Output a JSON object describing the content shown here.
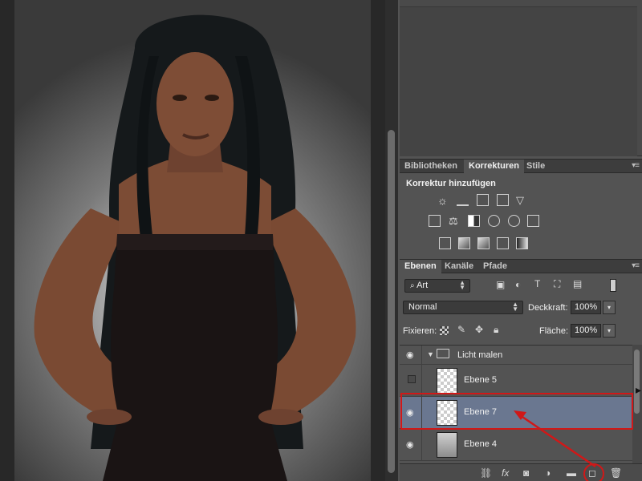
{
  "canvas": {
    "description_icon": "portrait-photo"
  },
  "adjustments_panel": {
    "tabs": [
      "Bibliotheken",
      "Korrekturen",
      "Stile"
    ],
    "active_tab": "Korrekturen",
    "title": "Korrektur hinzufügen"
  },
  "layers_panel": {
    "tabs": [
      "Ebenen",
      "Kanäle",
      "Pfade"
    ],
    "active_tab": "Ebenen",
    "filter_type": "Art",
    "blend_mode": "Normal",
    "opacity_label": "Deckkraft:",
    "opacity_value": "100%",
    "lock_label": "Fixieren:",
    "fill_label": "Fläche:",
    "fill_value": "100%",
    "layers": [
      {
        "name": "Licht malen",
        "type": "group",
        "visible": true
      },
      {
        "name": "Ebene 5",
        "type": "layer",
        "visible": false
      },
      {
        "name": "Ebene 7",
        "type": "layer",
        "visible": true,
        "selected": true
      },
      {
        "name": "Ebene 4",
        "type": "layer",
        "visible": true
      }
    ]
  },
  "colors": {
    "highlight": "#d01818",
    "selection": "#6a7790",
    "panel_bg": "#535353"
  }
}
